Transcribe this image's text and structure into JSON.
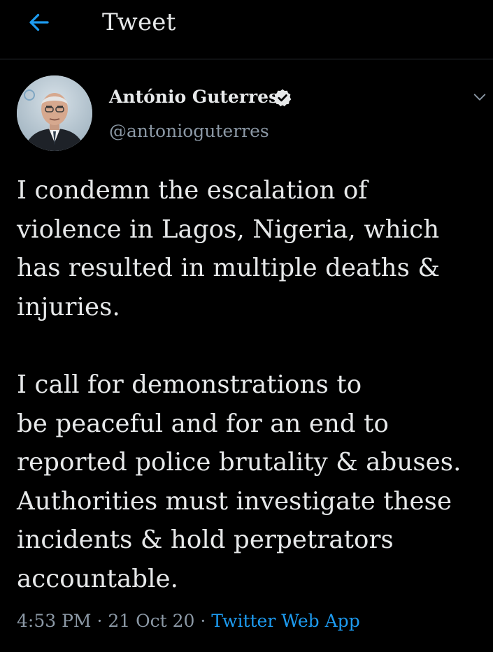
{
  "header": {
    "title": "Tweet",
    "back_icon": "arrow-left-icon"
  },
  "colors": {
    "background": "#000000",
    "text": "#e7e9ea",
    "secondary": "#8b98a5",
    "accent": "#1d9bf0"
  },
  "tweet": {
    "author_name": "António Guterres",
    "author_handle": "@antonioguterres",
    "verified": true,
    "text_lines": [
      "I condemn the escalation of",
      "violence in Lagos, Nigeria, which",
      "has resulted in multiple deaths &",
      "injuries.",
      "",
      "I call for demonstrations to",
      "be peaceful and for an end to",
      "reported police brutality & abuses.",
      "Authorities must investigate these",
      "incidents & hold perpetrators",
      "accountable."
    ],
    "time": "4:53 PM",
    "separator": " · ",
    "date": "21 Oct 20",
    "source": "Twitter Web App"
  }
}
